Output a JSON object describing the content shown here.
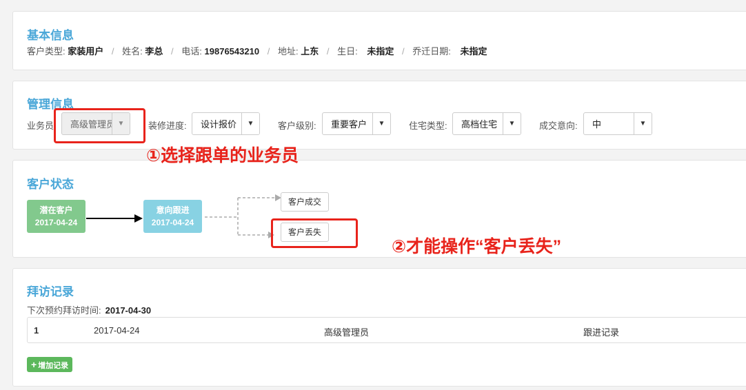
{
  "basic": {
    "title": "基本信息",
    "customer_type_label": "客户类型:",
    "customer_type": "家装用户",
    "name_label": "姓名:",
    "name": "李总",
    "phone_label": "电话:",
    "phone": "19876543210",
    "address_label": "地址:",
    "address": "上东",
    "birthday_label": "生日:",
    "birthday": "未指定",
    "move_date_label": "乔迁日期:",
    "move_date": "未指定",
    "separator": "/"
  },
  "management": {
    "title": "管理信息",
    "salesman_label": "业务员:",
    "salesman_value": "高级管理员",
    "progress_label": "装修进度:",
    "progress_value": "设计报价",
    "level_label": "客户级别:",
    "level_value": "重要客户",
    "housing_label": "住宅类型:",
    "housing_value": "高档住宅",
    "intent_label": "成交意向:",
    "intent_value": "中",
    "caret": "▼"
  },
  "status": {
    "title": "客户状态",
    "step1_label": "潜在客户",
    "step1_date": "2017-04-24",
    "step2_label": "意向跟进",
    "step2_date": "2017-04-24",
    "deal_button": "客户成交",
    "lost_button": "客户丢失"
  },
  "visits": {
    "title": "拜访记录",
    "next_label": "下次预约拜访时间:",
    "next_date": "2017-04-30",
    "rows": [
      {
        "index": "1",
        "date": "2017-04-24",
        "person": "高级管理员",
        "type": "跟进记录"
      }
    ],
    "add_plus": "+",
    "add_button": "增加记录"
  },
  "annotations": {
    "note1": "①选择跟单的业务员",
    "note2": "②才能操作“客户丢失”",
    "color": "#e8231b"
  }
}
